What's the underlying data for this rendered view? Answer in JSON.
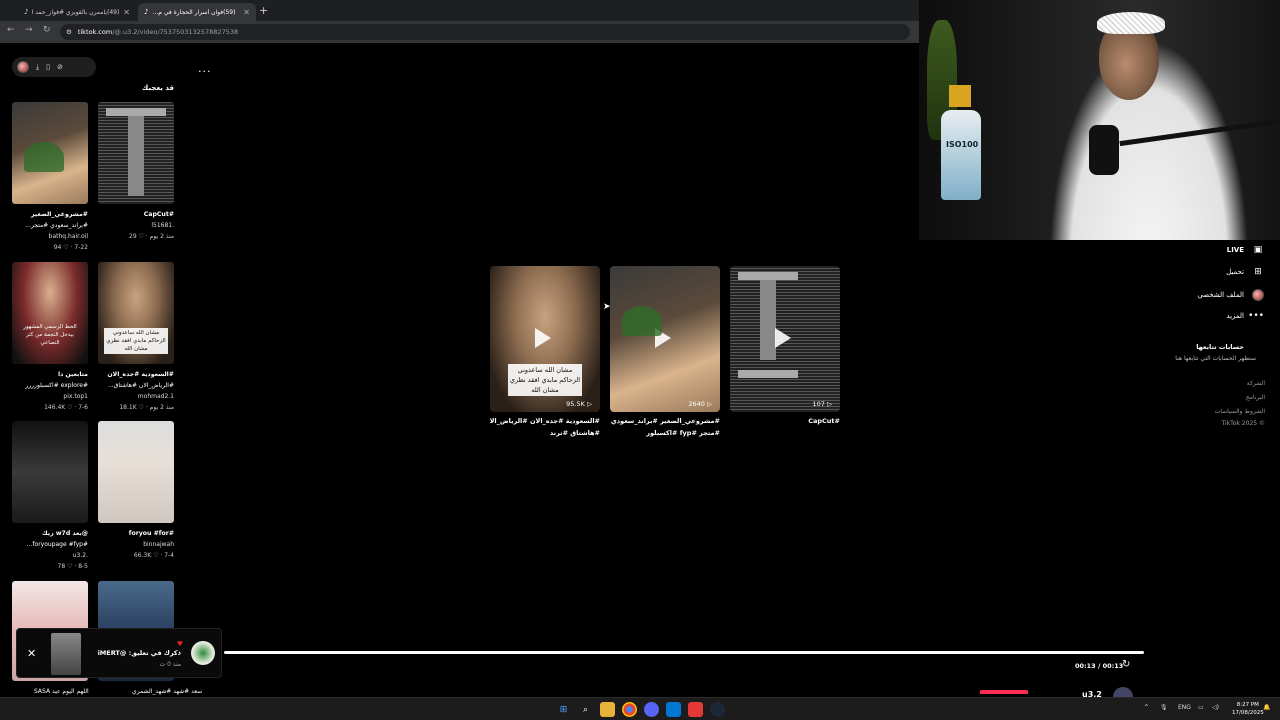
{
  "browser": {
    "tabs": [
      {
        "title": "(49)ياممرن بالقويزي #فواز_حمد ا..."
      },
      {
        "title": "(59)فوان أسرار الحجارة في م..."
      }
    ],
    "new_tab": "+",
    "url_domain": "tiktok.com",
    "url_path": "/@.u3.2/video/7537503132578827538"
  },
  "toolbar": {
    "more": "..."
  },
  "section_title": "قد يعجبك",
  "grid": [
    {
      "caption": "#CapCut",
      "user": "l51681.",
      "meta": "29 ♡ · منذ 2 يوم"
    },
    {
      "caption": "#مشروعي_الصغير",
      "caption2": "#براند_سعودي #متجر...",
      "user": "bathq.hair.oil",
      "meta": "94 ♡ · 7-22"
    },
    {
      "caption": "#السعودية #جده_الان",
      "caption2": "#الرياض_الان #هاشتاق...",
      "user": "mohmad2.1",
      "meta": "18.1K ♡ · منذ 2 يوم"
    },
    {
      "caption": "متابعين دا",
      "caption2": "#explore #اكسبلورررر",
      "user": "pix.top1",
      "meta": "146.4K ♡ · 7-6"
    },
    {
      "caption": "#foryou #for",
      "user": "binnajwah",
      "meta": "66.3K ♡ · 7-4"
    },
    {
      "caption": "@بعد w7d ريك",
      "caption2": "#foryoupage #fyp...",
      "user": "u3.2.",
      "meta": "78 ♡ · 8-5"
    }
  ],
  "grid_overlay": {
    "man": "مشان الله ساعدوني الزحاكم مابدي افقد نظري مشان الله",
    "saudi": "الخط الرسمي المشهور بيدخل النجمة من كثر التصاعي"
  },
  "videos": [
    {
      "count": "95.5K",
      "caption": "#السعودية #جده_الان #الرياض_الان",
      "caption2": "#هاشتاق #ترند",
      "overlay": "مشان الله ساعدوني الزحاكم مابدي افقد نظري مشان الله"
    },
    {
      "count": "2640",
      "caption": "#مشروعي_الصغير #براند_سعودي",
      "caption2": "#متجر #fyp #اكسبلور"
    },
    {
      "count": "107",
      "caption": "#CapCut"
    }
  ],
  "sidebar": {
    "items": [
      {
        "label": "LIVE"
      },
      {
        "label": "تحميل"
      },
      {
        "label": "الملف الشخصي"
      },
      {
        "label": "المزيد"
      }
    ],
    "following_title": "حسابات تتابعها",
    "following_sub": "ستظهر الحسابات التي تتابعها هنا",
    "footer": [
      "الشركة",
      "البرنامج",
      "الشروط والسياسات",
      "© TikTok 2025"
    ]
  },
  "webcam": {
    "bottle_label": "ISO100"
  },
  "player": {
    "time": "00:13 / 00:13",
    "progress": 1.0,
    "bottom_user": "u3.2"
  },
  "toast": {
    "text": "ذكرك في تعليق: @iMERT",
    "time": "منذ 0 ث"
  },
  "bottom_captions": [
    "سعد #شهد #شهد_الشمري",
    "اللهم اليوم عيد SASA"
  ],
  "taskbar": {
    "lang": "ENG",
    "time": "8:27 PM",
    "date": "17/08/2025"
  },
  "colors": {
    "accent": "#fe2c55",
    "bg": "#000000"
  }
}
